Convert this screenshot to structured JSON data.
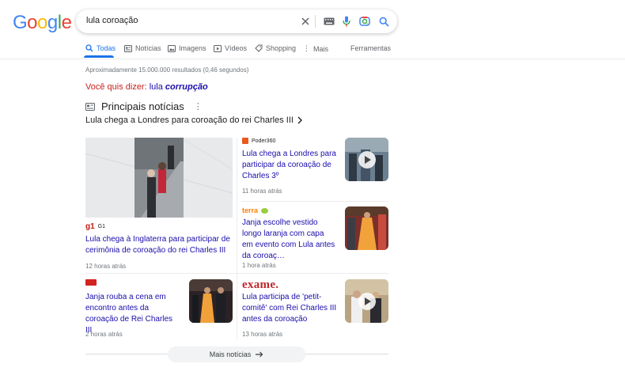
{
  "logo": [
    "G",
    "o",
    "o",
    "g",
    "l",
    "e"
  ],
  "logo_colors": [
    "#4285f4",
    "#ea4335",
    "#fbbc05",
    "#4285f4",
    "#34a853",
    "#ea4335"
  ],
  "search": {
    "query": "lula coroação"
  },
  "tabs": [
    {
      "label": "Todas",
      "icon": "search-icon",
      "active": true
    },
    {
      "label": "Notícias",
      "icon": "news-icon"
    },
    {
      "label": "Imagens",
      "icon": "image-icon"
    },
    {
      "label": "Vídeos",
      "icon": "video-icon"
    },
    {
      "label": "Shopping",
      "icon": "tag-icon"
    },
    {
      "label": "Mais",
      "icon": "more-icon"
    }
  ],
  "tools_label": "Ferramentas",
  "result_stats": "Aproximadamente 15.000.000 resultados (0,46 segundos)",
  "did_you_mean": {
    "prefix": "Você quis dizer:",
    "plain": "lula",
    "emphasis": "corrupção"
  },
  "top_stories": {
    "title": "Principais notícias",
    "subheading": "Lula chega a Londres para coroação do rei Charles III",
    "big_card": {
      "source_logo": "g1",
      "source": "G1",
      "headline": "Lula chega à Inglaterra para participar de cerimônia de coroação do rei Charles III",
      "time": "12 horas atrás"
    },
    "cards": [
      {
        "source": "Poder360",
        "headline": "Lula chega a Londres para participar da coroação de Charles 3º",
        "time": "11 horas atrás",
        "video": true
      },
      {
        "source": "terra",
        "headline": "Janja escolhe vestido longo laranja com capa em evento com Lula antes da coroaç…",
        "time": "1 hora atrás",
        "video": false
      },
      {
        "source": "",
        "headline": "Janja rouba a cena em encontro antes da coroação de Rei Charles III",
        "time": "2 horas atrás",
        "video": false
      },
      {
        "source": "exame.",
        "headline": "Lula participa de 'petit-comitê' com Rei Charles III antes da coroação",
        "time": "13 horas atrás",
        "video": true
      }
    ]
  },
  "more_news_label": "Mais notícias",
  "colors": {
    "link": "#1a0dab",
    "accent": "#1a73e8",
    "did_you_mean": "#c5221f",
    "exame_red": "#c0272d",
    "terra_orange": "#ff7e00"
  }
}
